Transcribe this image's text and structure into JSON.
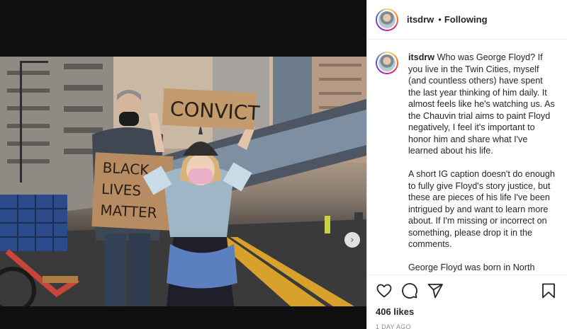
{
  "post": {
    "username": "itsdrw",
    "follow_status": "Following",
    "more_label": "•••",
    "photo_sign_convict": "CONVICT",
    "photo_sign_blm": "BLACK LIVES MATTER",
    "caption": {
      "username": "itsdrw",
      "text": " Who was George Floyd? If you live in the Twin Cities, myself (and countless others) have spent the last year thinking of him daily. It almost feels like he's watching us. As the Chauvin trial aims to paint Floyd negatively, I feel it's important to honor him and share what I've learned about his life.\n\nA short IG caption doesn't do enough to fully give Floyd's story justice, but these are pieces of his life I've been intrigued by and want to learn more about. If I'm missing or incorrect on something, please drop it in the comments.\n\nGeorge Floyd was born in North Carolina and grew up in Houston,"
    },
    "likes": "406 likes",
    "timestamp": "1 DAY AGO"
  },
  "icons": {
    "like": "heart-icon",
    "comment": "comment-icon",
    "share": "share-icon",
    "save": "bookmark-icon",
    "next": "chevron-right-icon"
  },
  "colors": {
    "text": "#262626",
    "muted": "#8e8e8e",
    "border": "#dbdbdb"
  }
}
